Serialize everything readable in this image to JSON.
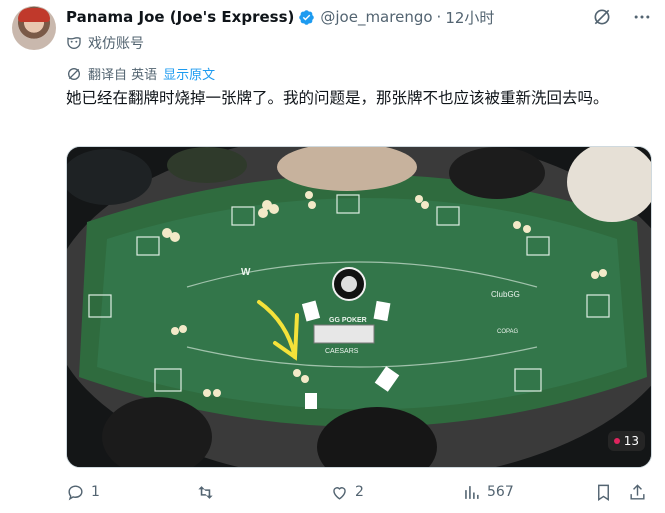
{
  "author": {
    "name": "Panama Joe (Joe's Express)",
    "handle": "@joe_marengo",
    "separator": "·",
    "time": "12小时",
    "label": "戏仿账号"
  },
  "translation": {
    "label": "翻译自 英语",
    "show_original": "显示原文"
  },
  "tweet": {
    "text": "她已经在翻牌时烧掉一张牌了。我的问题是，那张牌不也应该被重新洗回去吗。"
  },
  "media": {
    "table_logos": [
      "W",
      "GG POKER",
      "CAESARS",
      "ClubGG",
      "COPAG"
    ],
    "viewer_count": "13"
  },
  "actions": {
    "replies": "1",
    "retweets": "",
    "likes": "2",
    "views": "567"
  },
  "colors": {
    "felt": "#2f6b3e",
    "rail": "#2b2b2b",
    "accent": "#1d9bf0",
    "arrow": "#f5e23a"
  },
  "icons": [
    "verified-icon",
    "grok-icon",
    "more-icon",
    "parody-mask-icon",
    "translate-icon",
    "reply-icon",
    "retweet-icon",
    "like-icon",
    "views-icon",
    "bookmark-icon",
    "share-icon"
  ]
}
